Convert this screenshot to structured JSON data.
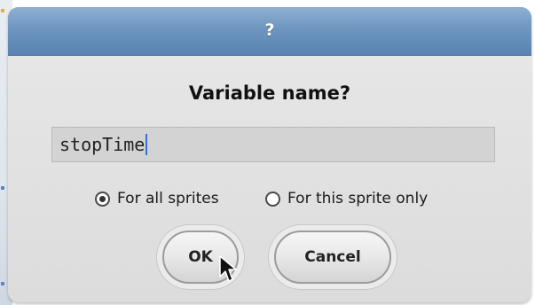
{
  "dialog": {
    "title": "?",
    "prompt": "Variable name?",
    "input": {
      "value": "stopTime"
    },
    "scope_options": [
      {
        "label": "For all sprites",
        "selected": true
      },
      {
        "label": "For this sprite only",
        "selected": false
      }
    ],
    "buttons": {
      "ok_label": "OK",
      "cancel_label": "Cancel"
    }
  },
  "colors": {
    "titlebar": "#6f96c0",
    "dialog_body": "#e0e0e0",
    "input_background": "#d3d3d3",
    "caret": "#3a6fd8"
  },
  "icons": {
    "cursor": "arrow-pointer-icon",
    "radio_selected": "radio-selected-icon",
    "radio_unselected": "radio-unselected-icon"
  }
}
